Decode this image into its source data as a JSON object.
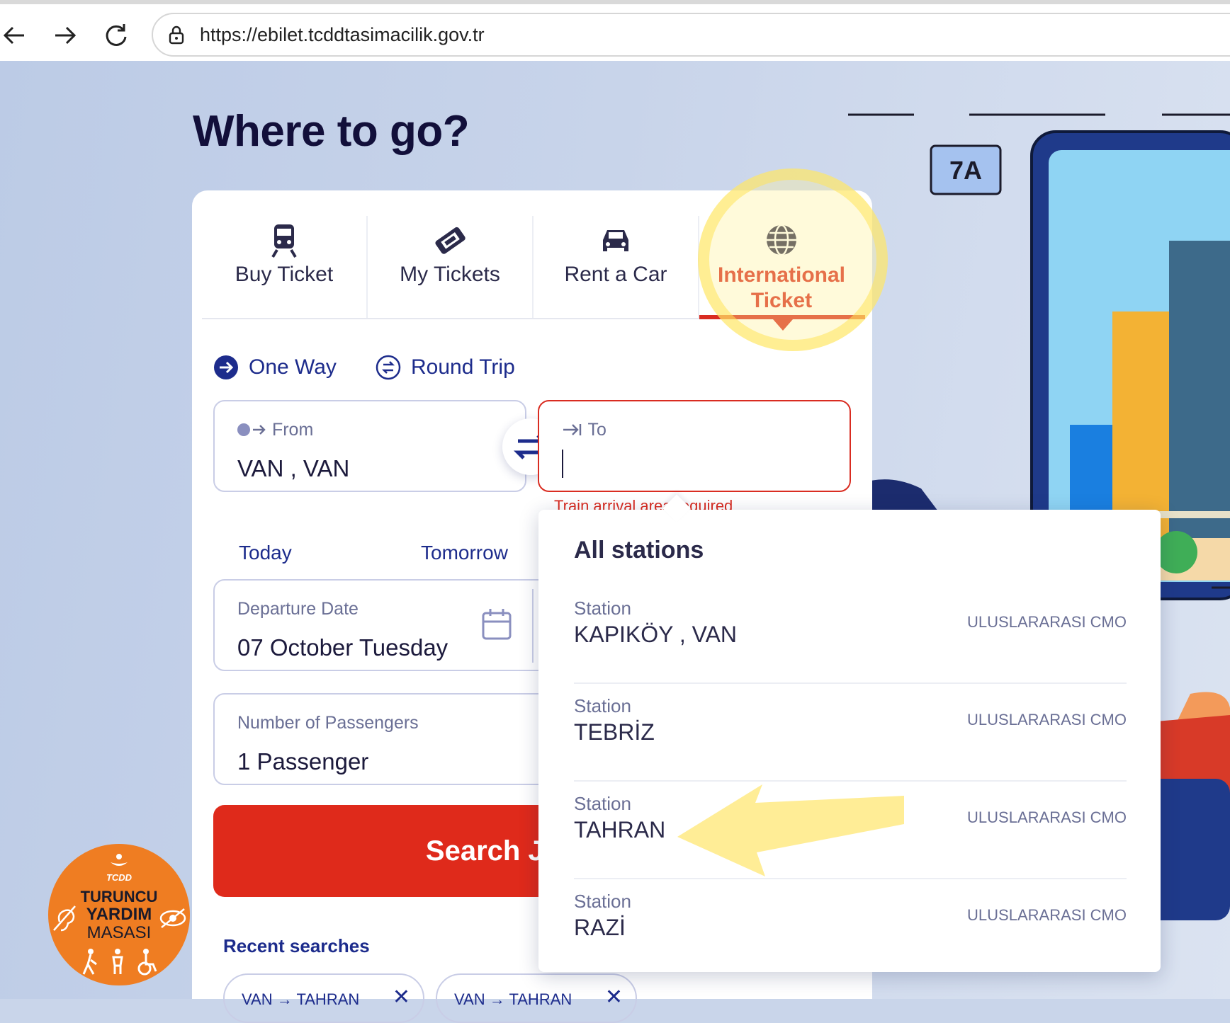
{
  "browser": {
    "url": "https://ebilet.tcddtasimacilik.gov.tr"
  },
  "page": {
    "heading": "Where to go?"
  },
  "tabs": [
    {
      "label": "Buy Ticket",
      "icon": "train-icon"
    },
    {
      "label": "My Tickets",
      "icon": "ticket-icon"
    },
    {
      "label": "Rent a Car",
      "icon": "car-icon"
    },
    {
      "label": "International Ticket",
      "icon": "globe-icon",
      "active": true
    }
  ],
  "trip_type": {
    "one_way": "One Way",
    "round_trip": "Round Trip",
    "selected": "One Way"
  },
  "from": {
    "label": "From",
    "value": "VAN , VAN"
  },
  "to": {
    "label": "To",
    "value": "",
    "error": "Train arrival area required"
  },
  "quick_dates": {
    "today": "Today",
    "tomorrow": "Tomorrow"
  },
  "departure": {
    "label": "Departure Date",
    "value": "07 October Tuesday"
  },
  "passengers": {
    "label": "Number of Passengers",
    "value": "1 Passenger"
  },
  "search_button": "Search Journey",
  "recent": {
    "title": "Recent searches",
    "items": [
      {
        "from": "VAN",
        "to": "TAHRAN"
      },
      {
        "from": "VAN",
        "to": "TAHRAN"
      }
    ]
  },
  "dropdown": {
    "title": "All stations",
    "stations": [
      {
        "label": "Station",
        "name": "KAPIKÖY , VAN",
        "type": "ULUSLARARASI CMO"
      },
      {
        "label": "Station",
        "name": "TEBRİZ",
        "type": "ULUSLARARASI CMO"
      },
      {
        "label": "Station",
        "name": "TAHRAN",
        "type": "ULUSLARARASI CMO"
      },
      {
        "label": "Station",
        "name": "RAZİ",
        "type": "ULUSLARARASI CMO"
      }
    ]
  },
  "illustration": {
    "seat_label": "7A"
  },
  "badge": {
    "brand": "TCDD",
    "line1": "TURUNCU",
    "line2": "YARDIM",
    "line3": "MASASI"
  },
  "colors": {
    "accent_red": "#d92c21",
    "navy": "#1d2c8c",
    "highlight_yellow": "#ffe45a",
    "badge_orange": "#ef7d22"
  }
}
